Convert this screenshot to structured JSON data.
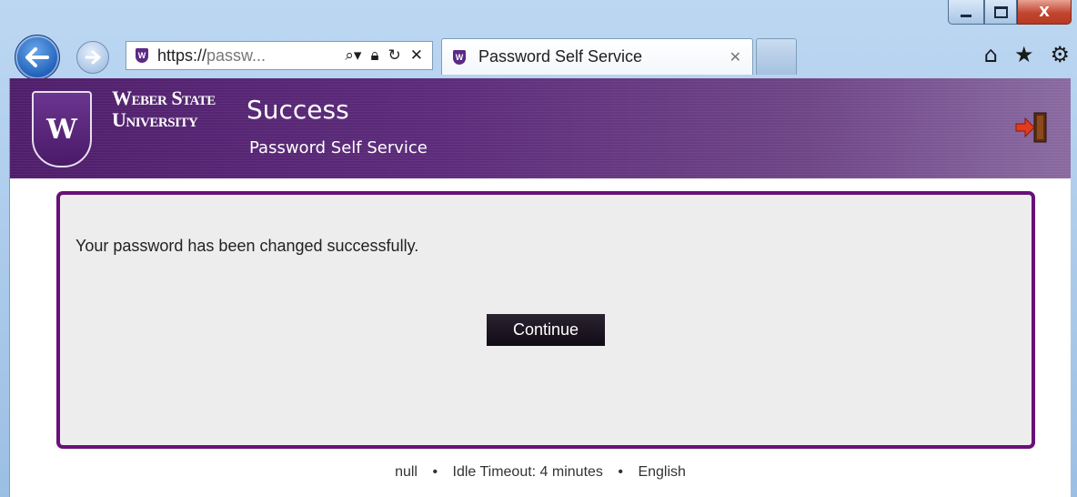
{
  "browser": {
    "url_prefix": "https://",
    "url_rest": "passw...",
    "tab_title": "Password Self Service",
    "tab_close": "✕",
    "window_controls": {
      "close_label": "X"
    }
  },
  "banner": {
    "university_line1": "Weber State",
    "university_line2": "University",
    "title": "Success",
    "subtitle": "Password Self Service"
  },
  "panel": {
    "message": "Your password has been changed successfully.",
    "continue_label": "Continue"
  },
  "footer": {
    "left": "null",
    "sep": "•",
    "middle": "Idle Timeout: 4 minutes",
    "right": "English"
  },
  "colors": {
    "brand_purple": "#5c2b7a",
    "panel_border": "#6a0f7a",
    "button_bg": "#1a1220"
  },
  "icons": [
    "back-icon",
    "forward-icon",
    "search-icon",
    "lock-icon",
    "refresh-icon",
    "stop-icon",
    "home-icon",
    "favorites-star-icon",
    "gear-icon",
    "exit-door-icon",
    "wsu-crest-icon"
  ]
}
